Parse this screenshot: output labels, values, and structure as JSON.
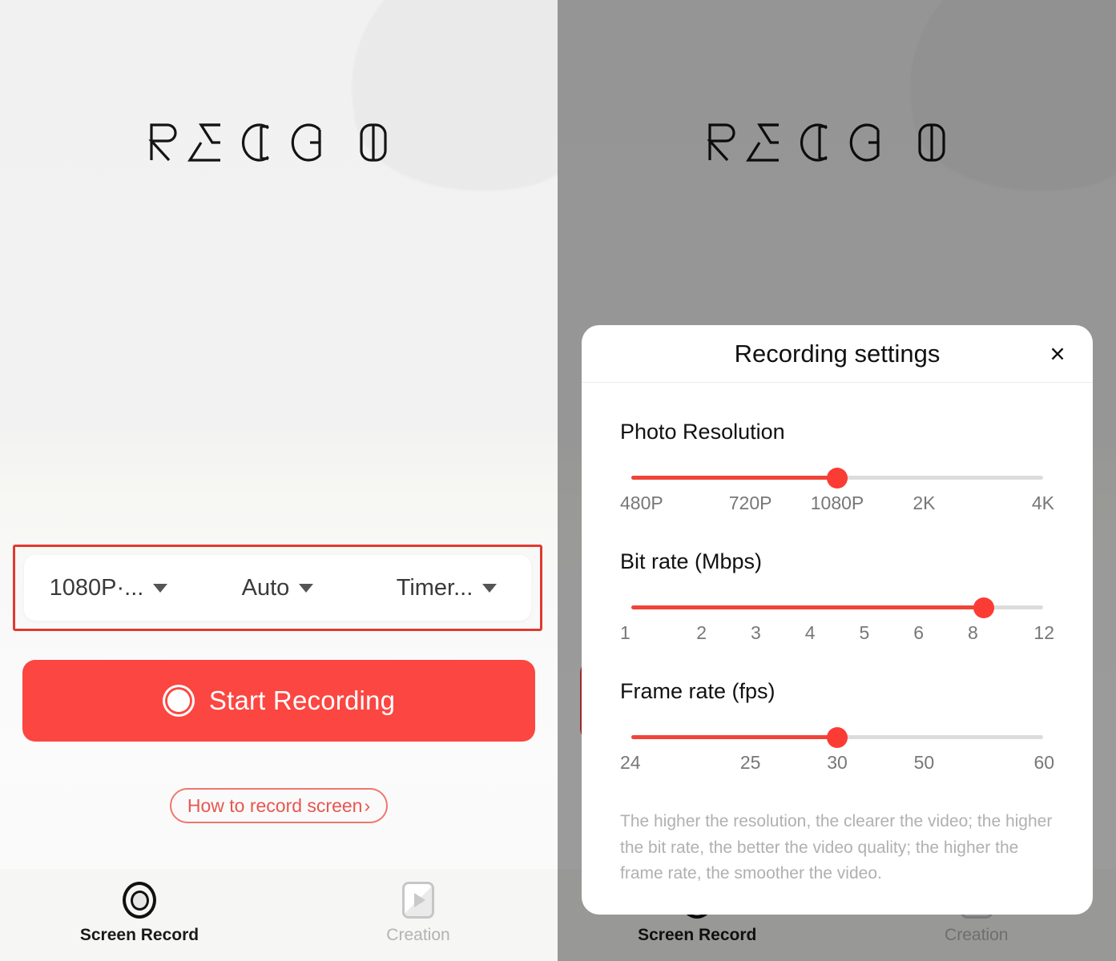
{
  "app": {
    "logo_text": "RECGO",
    "logo_letters": [
      "R",
      "E",
      "C",
      "G",
      "O"
    ]
  },
  "left_screen": {
    "options_bar": {
      "annotated": true,
      "annotation_color": "#e03a2f",
      "items": [
        {
          "label": "1080P·...",
          "name": "resolution-dropdown"
        },
        {
          "label": "Auto",
          "name": "orientation-dropdown"
        },
        {
          "label": "Timer...",
          "name": "timer-dropdown"
        }
      ]
    },
    "start_button": {
      "label": "Start Recording",
      "color": "#fc4641"
    },
    "how_to_button": {
      "label": "How to record screen",
      "chevron": "›",
      "color": "#e75650"
    }
  },
  "bottom_nav": {
    "items": [
      {
        "label": "Screen Record",
        "icon": "record-circle-icon",
        "active": true
      },
      {
        "label": "Creation",
        "icon": "play-square-icon",
        "active": false
      }
    ]
  },
  "right_screen": {
    "overlay_dim": true,
    "sheet": {
      "title": "Recording settings",
      "close_icon": "×",
      "note": "The higher the resolution, the clearer the video; the higher the bit rate, the better the video quality; the higher the frame rate, the smoother the video.",
      "accent_color": "#fa3c34",
      "groups": [
        {
          "title": "Photo Resolution",
          "name": "photo-resolution",
          "ticks": [
            "480P",
            "720P",
            "1080P",
            "2K",
            "4K"
          ],
          "selected": "1080P",
          "percent": 50
        },
        {
          "title": "Bit rate (Mbps)",
          "name": "bit-rate",
          "ticks": [
            "1",
            "2",
            "3",
            "4",
            "5",
            "6",
            "8",
            "12"
          ],
          "selected": "8",
          "percent": 85.7
        },
        {
          "title": "Frame rate (fps)",
          "name": "frame-rate",
          "ticks": [
            "24",
            "25",
            "30",
            "50",
            "60"
          ],
          "selected": "30",
          "percent": 50
        }
      ]
    }
  }
}
